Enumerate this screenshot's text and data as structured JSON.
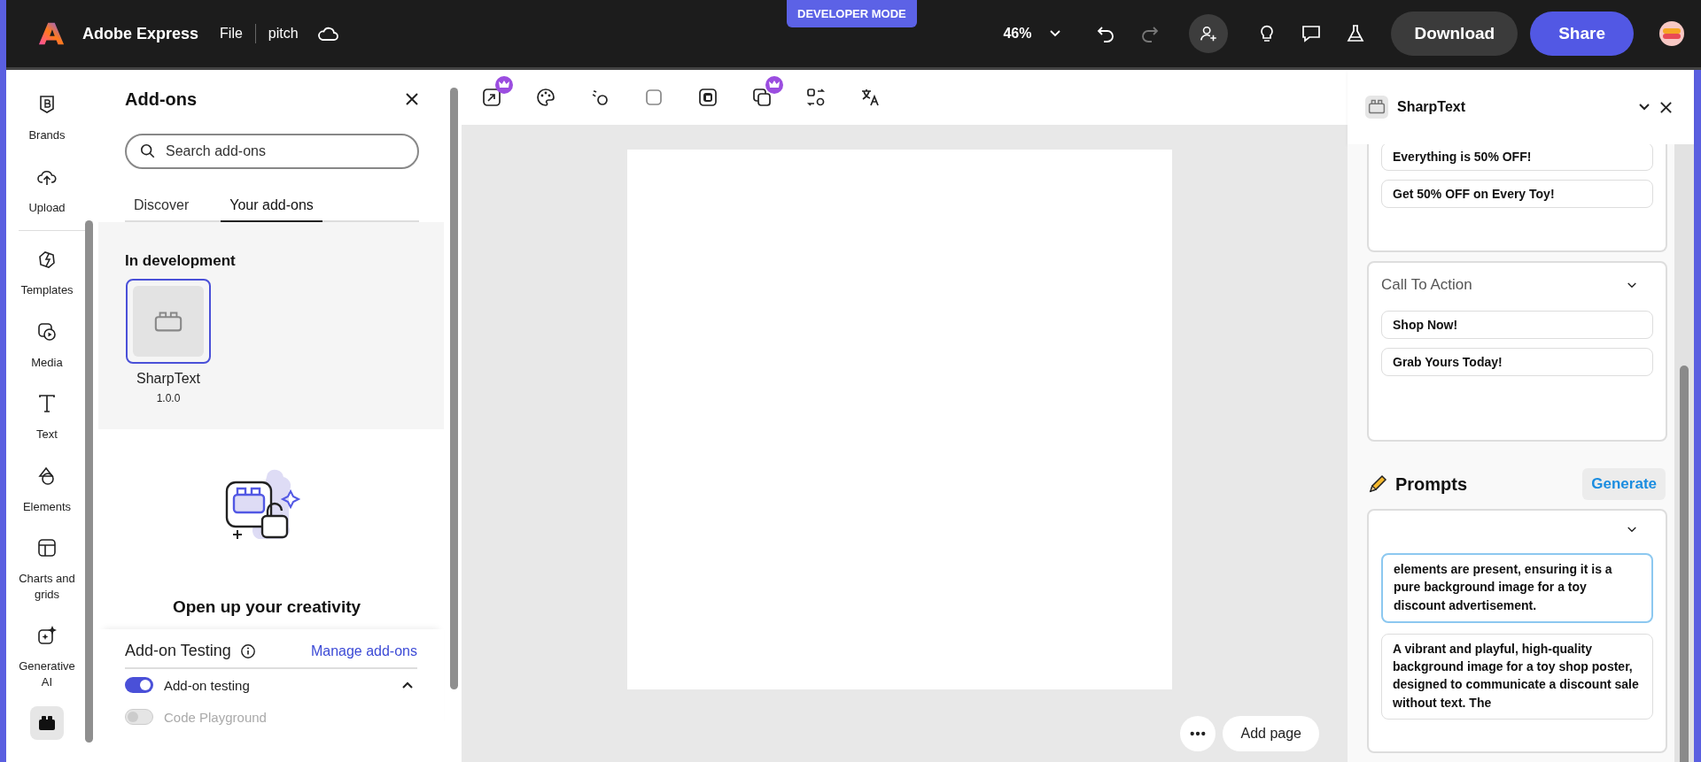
{
  "topbar": {
    "app_name": "Adobe Express",
    "menu": "File",
    "document": "pitch",
    "badge": "DEVELOPER MODE",
    "zoom": "46%",
    "download": "Download",
    "share": "Share"
  },
  "rail": [
    {
      "kind": "brands",
      "label": "Brands",
      "selected": false
    },
    {
      "kind": "upload",
      "label": "Upload",
      "selected": false
    },
    {
      "kind": "templates",
      "label": "Templates",
      "selected": false
    },
    {
      "kind": "media",
      "label": "Media",
      "selected": false
    },
    {
      "kind": "text",
      "label": "Text",
      "selected": false
    },
    {
      "kind": "elements",
      "label": "Elements",
      "selected": false
    },
    {
      "kind": "charts",
      "label": "Charts and grids",
      "selected": false
    },
    {
      "kind": "ai",
      "label": "Generative AI",
      "selected": false
    },
    {
      "kind": "addons",
      "selected": true
    }
  ],
  "addons_panel": {
    "title": "Add-ons",
    "search": {
      "placeholder": "Search add-ons"
    },
    "tabs": [
      {
        "label": "Discover",
        "selected": false
      },
      {
        "label": "Your add-ons",
        "selected": true
      }
    ],
    "section": "In development",
    "items": [
      {
        "name": "SharpText",
        "version": "1.0.0",
        "selected": true
      }
    ],
    "promo": "Open up your creativity",
    "testing": {
      "title": "Add-on Testing",
      "link": "Manage add-ons",
      "expanded": true,
      "toggles": [
        {
          "label": "Add-on testing",
          "on": true,
          "disabled": false
        },
        {
          "label": "Code Playground",
          "on": false,
          "disabled": true
        }
      ]
    }
  },
  "canvas": {
    "add_page": "Add page"
  },
  "sharptext": {
    "title": "SharpText",
    "groups": [
      {
        "options": [
          "Everything is 50% OFF!",
          "Get 50% OFF on Every Toy!"
        ]
      },
      {
        "title": "Call To Action",
        "options": [
          "Shop Now!",
          "Grab Yours Today!"
        ]
      }
    ],
    "prompts": {
      "title": "Prompts",
      "button": "Generate",
      "items": [
        {
          "text": "elements are present, ensuring it is a pure background image for a toy discount advertisement.",
          "selected": true
        },
        {
          "text": "A vibrant and playful, high-quality background image for a toy shop poster, designed to communicate a discount sale without text. The",
          "selected": false
        }
      ]
    }
  }
}
